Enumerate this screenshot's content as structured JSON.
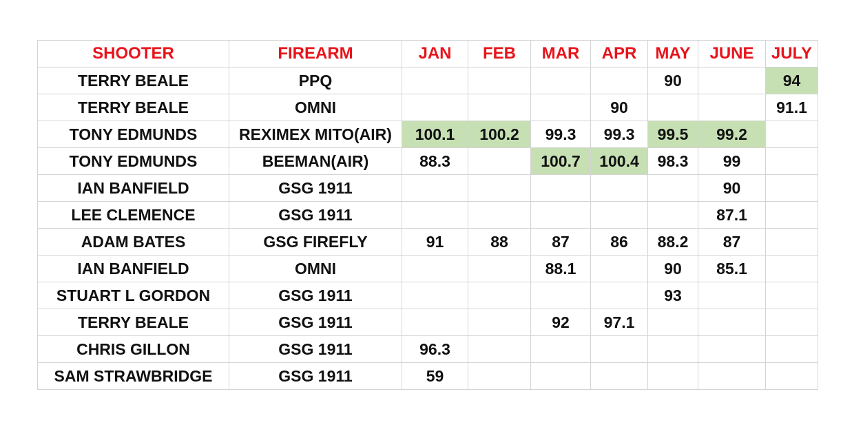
{
  "colors": {
    "header_text": "#e8131b",
    "highlight": "#c6e0b4",
    "grid": "#d4d4d4",
    "body_text": "#111111"
  },
  "headers": [
    "SHOOTER",
    "FIREARM",
    "JAN",
    "FEB",
    "MAR",
    "APR",
    "MAY",
    "JUNE",
    "JULY"
  ],
  "rows": [
    {
      "shooter": "TERRY BEALE",
      "firearm": "PPQ",
      "scores": [
        "",
        "",
        "",
        "",
        "90",
        "",
        "94"
      ],
      "highlight": [
        false,
        false,
        false,
        false,
        false,
        false,
        true
      ]
    },
    {
      "shooter": "TERRY BEALE",
      "firearm": "OMNI",
      "scores": [
        "",
        "",
        "",
        "90",
        "",
        "",
        "91.1"
      ],
      "highlight": [
        false,
        false,
        false,
        false,
        false,
        false,
        false
      ]
    },
    {
      "shooter": "TONY EDMUNDS",
      "firearm": "REXIMEX MITO(AIR)",
      "scores": [
        "100.1",
        "100.2",
        "99.3",
        "99.3",
        "99.5",
        "99.2",
        ""
      ],
      "highlight": [
        true,
        true,
        false,
        false,
        true,
        true,
        false
      ]
    },
    {
      "shooter": "TONY EDMUNDS",
      "firearm": "BEEMAN(AIR)",
      "scores": [
        "88.3",
        "",
        "100.7",
        "100.4",
        "98.3",
        "99",
        ""
      ],
      "highlight": [
        false,
        false,
        true,
        true,
        false,
        false,
        false
      ]
    },
    {
      "shooter": "IAN BANFIELD",
      "firearm": "GSG 1911",
      "scores": [
        "",
        "",
        "",
        "",
        "",
        "90",
        ""
      ],
      "highlight": [
        false,
        false,
        false,
        false,
        false,
        false,
        false
      ]
    },
    {
      "shooter": "LEE CLEMENCE",
      "firearm": "GSG 1911",
      "scores": [
        "",
        "",
        "",
        "",
        "",
        "87.1",
        ""
      ],
      "highlight": [
        false,
        false,
        false,
        false,
        false,
        false,
        false
      ]
    },
    {
      "shooter": "ADAM BATES",
      "firearm": "GSG FIREFLY",
      "scores": [
        "91",
        "88",
        "87",
        "86",
        "88.2",
        "87",
        ""
      ],
      "highlight": [
        false,
        false,
        false,
        false,
        false,
        false,
        false
      ]
    },
    {
      "shooter": "IAN BANFIELD",
      "firearm": "OMNI",
      "scores": [
        "",
        "",
        "88.1",
        "",
        "90",
        "85.1",
        ""
      ],
      "highlight": [
        false,
        false,
        false,
        false,
        false,
        false,
        false
      ]
    },
    {
      "shooter": "STUART L GORDON",
      "firearm": "GSG 1911",
      "scores": [
        "",
        "",
        "",
        "",
        "93",
        "",
        ""
      ],
      "highlight": [
        false,
        false,
        false,
        false,
        false,
        false,
        false
      ]
    },
    {
      "shooter": "TERRY BEALE",
      "firearm": "GSG 1911",
      "scores": [
        "",
        "",
        "92",
        "97.1",
        "",
        "",
        ""
      ],
      "highlight": [
        false,
        false,
        false,
        false,
        false,
        false,
        false
      ]
    },
    {
      "shooter": "CHRIS GILLON",
      "firearm": "GSG 1911",
      "scores": [
        "96.3",
        "",
        "",
        "",
        "",
        "",
        ""
      ],
      "highlight": [
        false,
        false,
        false,
        false,
        false,
        false,
        false
      ]
    },
    {
      "shooter": "SAM STRAWBRIDGE",
      "firearm": "GSG 1911",
      "scores": [
        "59",
        "",
        "",
        "",
        "",
        "",
        ""
      ],
      "highlight": [
        false,
        false,
        false,
        false,
        false,
        false,
        false
      ]
    }
  ]
}
